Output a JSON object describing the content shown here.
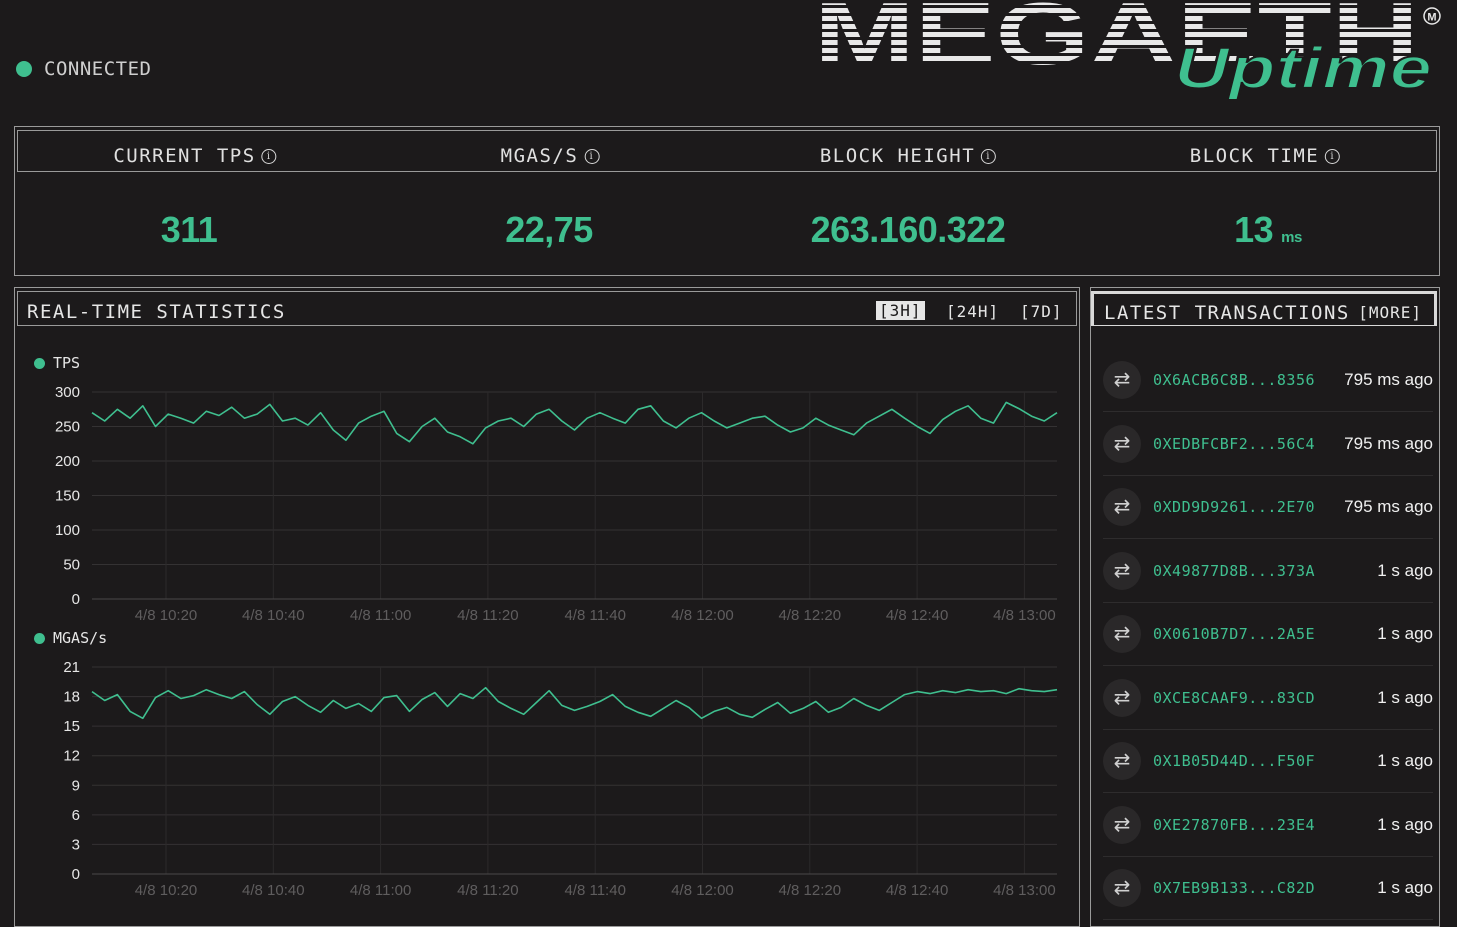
{
  "connection": {
    "status": "CONNECTED"
  },
  "brand": {
    "name": "MEGAETH",
    "sub": "Uptime",
    "mark": "M"
  },
  "stats": [
    {
      "label": "CURRENT TPS",
      "value": "311",
      "unit": ""
    },
    {
      "label": "MGAS/S",
      "value": "22,75",
      "unit": ""
    },
    {
      "label": "BLOCK HEIGHT",
      "value": "263.160.322",
      "unit": ""
    },
    {
      "label": "BLOCK TIME",
      "value": "13",
      "unit": "ms"
    }
  ],
  "statistics": {
    "title": "REAL-TIME STATISTICS",
    "ranges": [
      "[3H]",
      "[24H]",
      "[7D]"
    ],
    "active_range": "[3H]"
  },
  "transactions": {
    "title": "LATEST TRANSACTIONS",
    "more_label": "[MORE]",
    "items": [
      {
        "hash": "0X6ACB6C8B...8356",
        "time": "795 ms ago"
      },
      {
        "hash": "0XEDBFCBF2...56C4",
        "time": "795 ms ago"
      },
      {
        "hash": "0XDD9D9261...2E70",
        "time": "795 ms ago"
      },
      {
        "hash": "0X49877D8B...373A",
        "time": "1 s ago"
      },
      {
        "hash": "0X0610B7D7...2A5E",
        "time": "1 s ago"
      },
      {
        "hash": "0XCE8CAAF9...83CD",
        "time": "1 s ago"
      },
      {
        "hash": "0X1B05D44D...F50F",
        "time": "1 s ago"
      },
      {
        "hash": "0XE27870FB...23E4",
        "time": "1 s ago"
      },
      {
        "hash": "0X7EB9B133...C82D",
        "time": "1 s ago"
      }
    ]
  },
  "colors": {
    "accent": "#3fbf8f",
    "background": "#1c1a1b",
    "border": "#9a9a9a"
  },
  "chart_data": [
    {
      "type": "line",
      "series": [
        {
          "name": "TPS"
        }
      ],
      "x": [
        "4/8 10:20",
        "4/8 10:40",
        "4/8 11:00",
        "4/8 11:20",
        "4/8 11:40",
        "4/8 12:00",
        "4/8 12:20",
        "4/8 12:40",
        "4/8 13:00"
      ],
      "y_ticks": [
        0,
        50,
        100,
        150,
        200,
        250,
        300
      ],
      "ylim": [
        0,
        300
      ],
      "grid": true,
      "legend": "top-left",
      "values": [
        270,
        258,
        275,
        262,
        280,
        250,
        268,
        262,
        255,
        272,
        266,
        278,
        262,
        268,
        282,
        258,
        262,
        252,
        270,
        245,
        230,
        255,
        265,
        272,
        240,
        228,
        250,
        262,
        242,
        235,
        225,
        248,
        258,
        262,
        250,
        268,
        275,
        258,
        245,
        262,
        270,
        262,
        255,
        275,
        280,
        258,
        248,
        262,
        270,
        258,
        248,
        255,
        262,
        265,
        252,
        242,
        248,
        262,
        252,
        245,
        238,
        255,
        265,
        275,
        262,
        250,
        240,
        260,
        272,
        280,
        262,
        255,
        285,
        276,
        265,
        258,
        270
      ]
    },
    {
      "type": "line",
      "series": [
        {
          "name": "MGAS/s"
        }
      ],
      "x": [
        "4/8 10:20",
        "4/8 10:40",
        "4/8 11:00",
        "4/8 11:20",
        "4/8 11:40",
        "4/8 12:00",
        "4/8 12:20",
        "4/8 12:40",
        "4/8 13:00"
      ],
      "y_ticks": [
        0,
        3,
        6,
        9,
        12,
        15,
        18,
        21
      ],
      "ylim": [
        0,
        21
      ],
      "grid": true,
      "legend": "top-left",
      "values": [
        18.5,
        17.6,
        18.2,
        16.5,
        15.8,
        17.9,
        18.6,
        17.8,
        18.1,
        18.7,
        18.2,
        17.8,
        18.5,
        17.2,
        16.2,
        17.5,
        18.0,
        17.1,
        16.4,
        17.6,
        16.8,
        17.3,
        16.5,
        17.9,
        18.1,
        16.5,
        17.7,
        18.4,
        17.0,
        18.3,
        17.8,
        18.9,
        17.5,
        16.8,
        16.2,
        17.4,
        18.6,
        17.1,
        16.6,
        17.0,
        17.5,
        18.2,
        17.0,
        16.4,
        16.0,
        16.8,
        17.6,
        16.9,
        15.8,
        16.5,
        16.9,
        16.2,
        15.9,
        16.7,
        17.4,
        16.3,
        16.8,
        17.5,
        16.4,
        16.9,
        17.8,
        17.1,
        16.6,
        17.4,
        18.2,
        18.5,
        18.3,
        18.6,
        18.4,
        18.7,
        18.5,
        18.6,
        18.3,
        18.8,
        18.6,
        18.5,
        18.7
      ]
    }
  ]
}
